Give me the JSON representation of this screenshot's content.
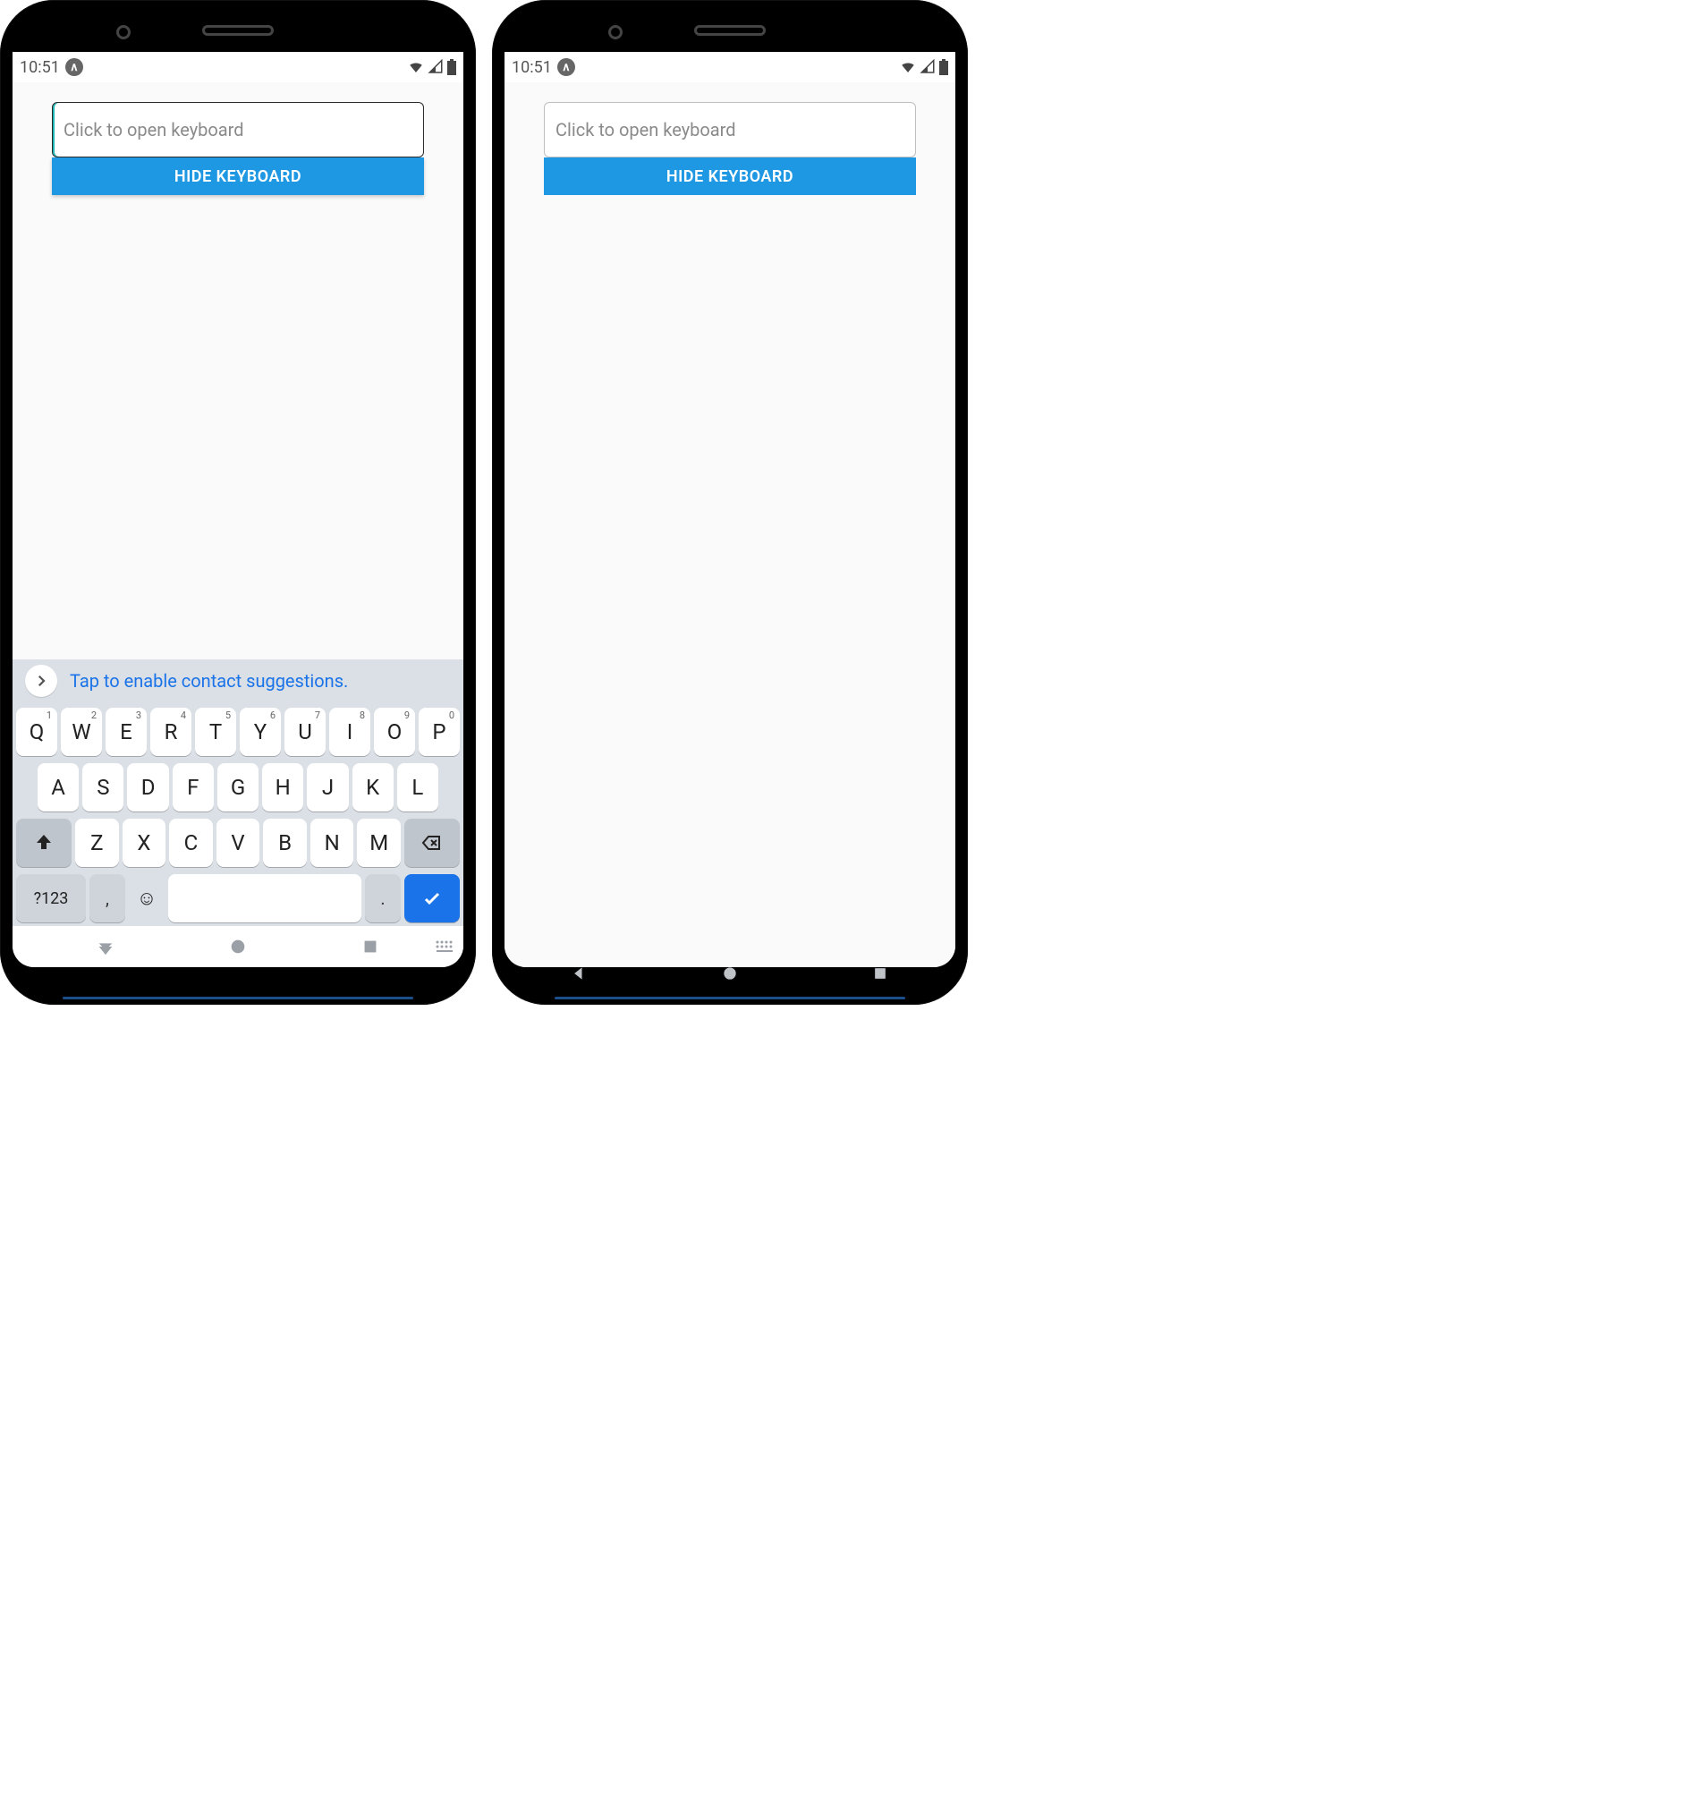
{
  "status": {
    "time": "10:51",
    "expo_glyph": "∧"
  },
  "app": {
    "input_placeholder": "Click to open keyboard",
    "input_value": "",
    "hide_button_label": "HIDE KEYBOARD"
  },
  "keyboard": {
    "suggestion_text": "Tap to enable contact suggestions.",
    "row1": [
      {
        "label": "Q",
        "sup": "1"
      },
      {
        "label": "W",
        "sup": "2"
      },
      {
        "label": "E",
        "sup": "3"
      },
      {
        "label": "R",
        "sup": "4"
      },
      {
        "label": "T",
        "sup": "5"
      },
      {
        "label": "Y",
        "sup": "6"
      },
      {
        "label": "U",
        "sup": "7"
      },
      {
        "label": "I",
        "sup": "8"
      },
      {
        "label": "O",
        "sup": "9"
      },
      {
        "label": "P",
        "sup": "0"
      }
    ],
    "row2": [
      {
        "label": "A"
      },
      {
        "label": "S"
      },
      {
        "label": "D"
      },
      {
        "label": "F"
      },
      {
        "label": "G"
      },
      {
        "label": "H"
      },
      {
        "label": "J"
      },
      {
        "label": "K"
      },
      {
        "label": "L"
      }
    ],
    "row3": [
      {
        "label": "Z"
      },
      {
        "label": "X"
      },
      {
        "label": "C"
      },
      {
        "label": "V"
      },
      {
        "label": "B"
      },
      {
        "label": "N"
      },
      {
        "label": "M"
      }
    ],
    "symbols_label": "?123",
    "comma_label": ",",
    "period_label": "."
  }
}
